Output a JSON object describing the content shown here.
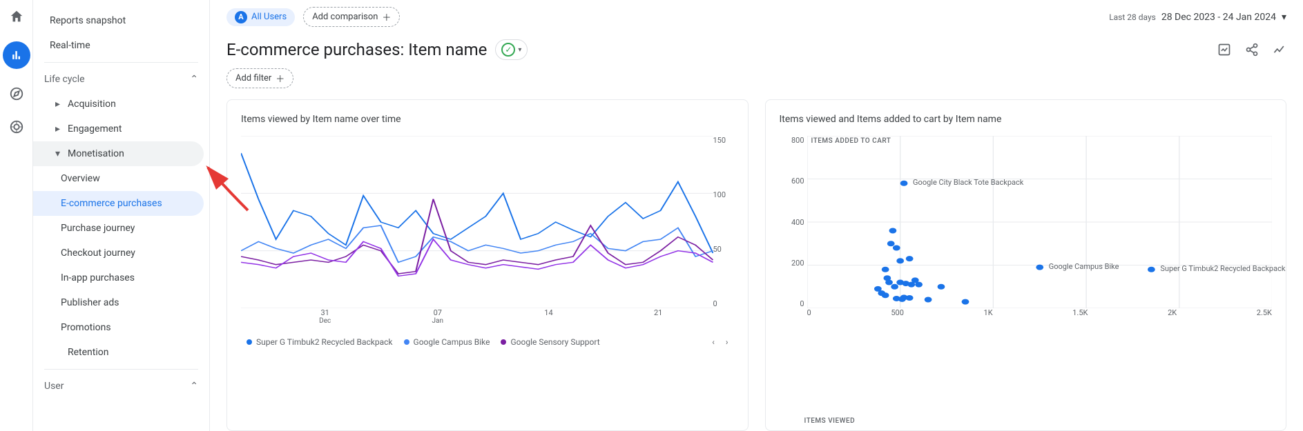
{
  "rail": {
    "icons": [
      "home",
      "reports",
      "explore",
      "advertising"
    ]
  },
  "sidebar": {
    "reports_snapshot": "Reports snapshot",
    "realtime": "Real-time",
    "lifecycle": "Life cycle",
    "acquisition": "Acquisition",
    "engagement": "Engagement",
    "monetisation": "Monetisation",
    "overview": "Overview",
    "ecommerce": "E-commerce purchases",
    "purchase_journey": "Purchase journey",
    "checkout_journey": "Checkout journey",
    "inapp": "In-app purchases",
    "publisher": "Publisher ads",
    "promotions": "Promotions",
    "retention": "Retention",
    "user": "User"
  },
  "header": {
    "all_users_badge": "A",
    "all_users": "All Users",
    "add_comparison": "Add comparison",
    "date_label": "Last 28 days",
    "date_range": "28 Dec 2023 - 24 Jan 2024",
    "title": "E-commerce purchases: Item name",
    "add_filter": "Add filter"
  },
  "chart_data": [
    {
      "type": "line",
      "title": "Items viewed by Item name over time",
      "ylim": [
        0,
        150
      ],
      "yticks": [
        0,
        50,
        100,
        150
      ],
      "xticks": [
        {
          "d": "31",
          "m": "Dec"
        },
        {
          "d": "07",
          "m": "Jan"
        },
        {
          "d": "14",
          "m": ""
        },
        {
          "d": "21",
          "m": ""
        }
      ],
      "series": [
        {
          "name": "Super G Timbuk2 Recycled Backpack",
          "color": "#1a73e8",
          "values": [
            135,
            95,
            60,
            85,
            80,
            65,
            55,
            98,
            75,
            70,
            85,
            65,
            60,
            70,
            80,
            100,
            60,
            65,
            75,
            68,
            62,
            80,
            92,
            78,
            85,
            110,
            80,
            48
          ]
        },
        {
          "name": "Google Campus Bike",
          "color": "#4285f4",
          "values": [
            50,
            58,
            52,
            48,
            55,
            60,
            52,
            70,
            72,
            40,
            45,
            62,
            58,
            50,
            55,
            52,
            48,
            50,
            55,
            58,
            65,
            52,
            50,
            58,
            60,
            70,
            45,
            50
          ]
        },
        {
          "name": "Google Sensory Support",
          "color": "#7b1fa2",
          "values": [
            45,
            42,
            38,
            40,
            42,
            40,
            45,
            55,
            50,
            30,
            32,
            95,
            50,
            40,
            38,
            42,
            40,
            38,
            42,
            45,
            72,
            48,
            38,
            40,
            50,
            62,
            55,
            42
          ]
        }
      ],
      "series4": {
        "color": "#9334e6",
        "values": [
          40,
          38,
          35,
          45,
          48,
          42,
          40,
          58,
          52,
          28,
          30,
          60,
          42,
          38,
          35,
          38,
          36,
          34,
          38,
          40,
          55,
          42,
          35,
          38,
          45,
          50,
          48,
          40
        ]
      }
    },
    {
      "type": "scatter",
      "title": "Items viewed and Items added to cart by Item name",
      "xlabel": "ITEMS VIEWED",
      "ylabel": "ITEMS ADDED TO CART",
      "xlim": [
        0,
        2500
      ],
      "xticks": [
        "0",
        "500",
        "1K",
        "1.5K",
        "2K",
        "2.5K"
      ],
      "ylim": [
        0,
        800
      ],
      "yticks": [
        0,
        200,
        400,
        600,
        800
      ],
      "points": [
        {
          "x": 520,
          "y": 580,
          "label": "Google City Black Tote Backpack"
        },
        {
          "x": 1850,
          "y": 180,
          "label": "Super G Timbuk2 Recycled Backpack"
        },
        {
          "x": 1250,
          "y": 190,
          "label": "Google Campus Bike"
        },
        {
          "x": 450,
          "y": 300
        },
        {
          "x": 480,
          "y": 280
        },
        {
          "x": 460,
          "y": 360
        },
        {
          "x": 500,
          "y": 220
        },
        {
          "x": 550,
          "y": 230
        },
        {
          "x": 420,
          "y": 180
        },
        {
          "x": 430,
          "y": 140
        },
        {
          "x": 440,
          "y": 120
        },
        {
          "x": 470,
          "y": 100
        },
        {
          "x": 380,
          "y": 90
        },
        {
          "x": 400,
          "y": 70
        },
        {
          "x": 420,
          "y": 60
        },
        {
          "x": 500,
          "y": 120
        },
        {
          "x": 530,
          "y": 115
        },
        {
          "x": 560,
          "y": 110
        },
        {
          "x": 580,
          "y": 130
        },
        {
          "x": 520,
          "y": 50
        },
        {
          "x": 550,
          "y": 48
        },
        {
          "x": 600,
          "y": 110
        },
        {
          "x": 720,
          "y": 100
        },
        {
          "x": 650,
          "y": 40
        },
        {
          "x": 850,
          "y": 30
        },
        {
          "x": 480,
          "y": 45
        },
        {
          "x": 510,
          "y": 42
        }
      ]
    }
  ]
}
